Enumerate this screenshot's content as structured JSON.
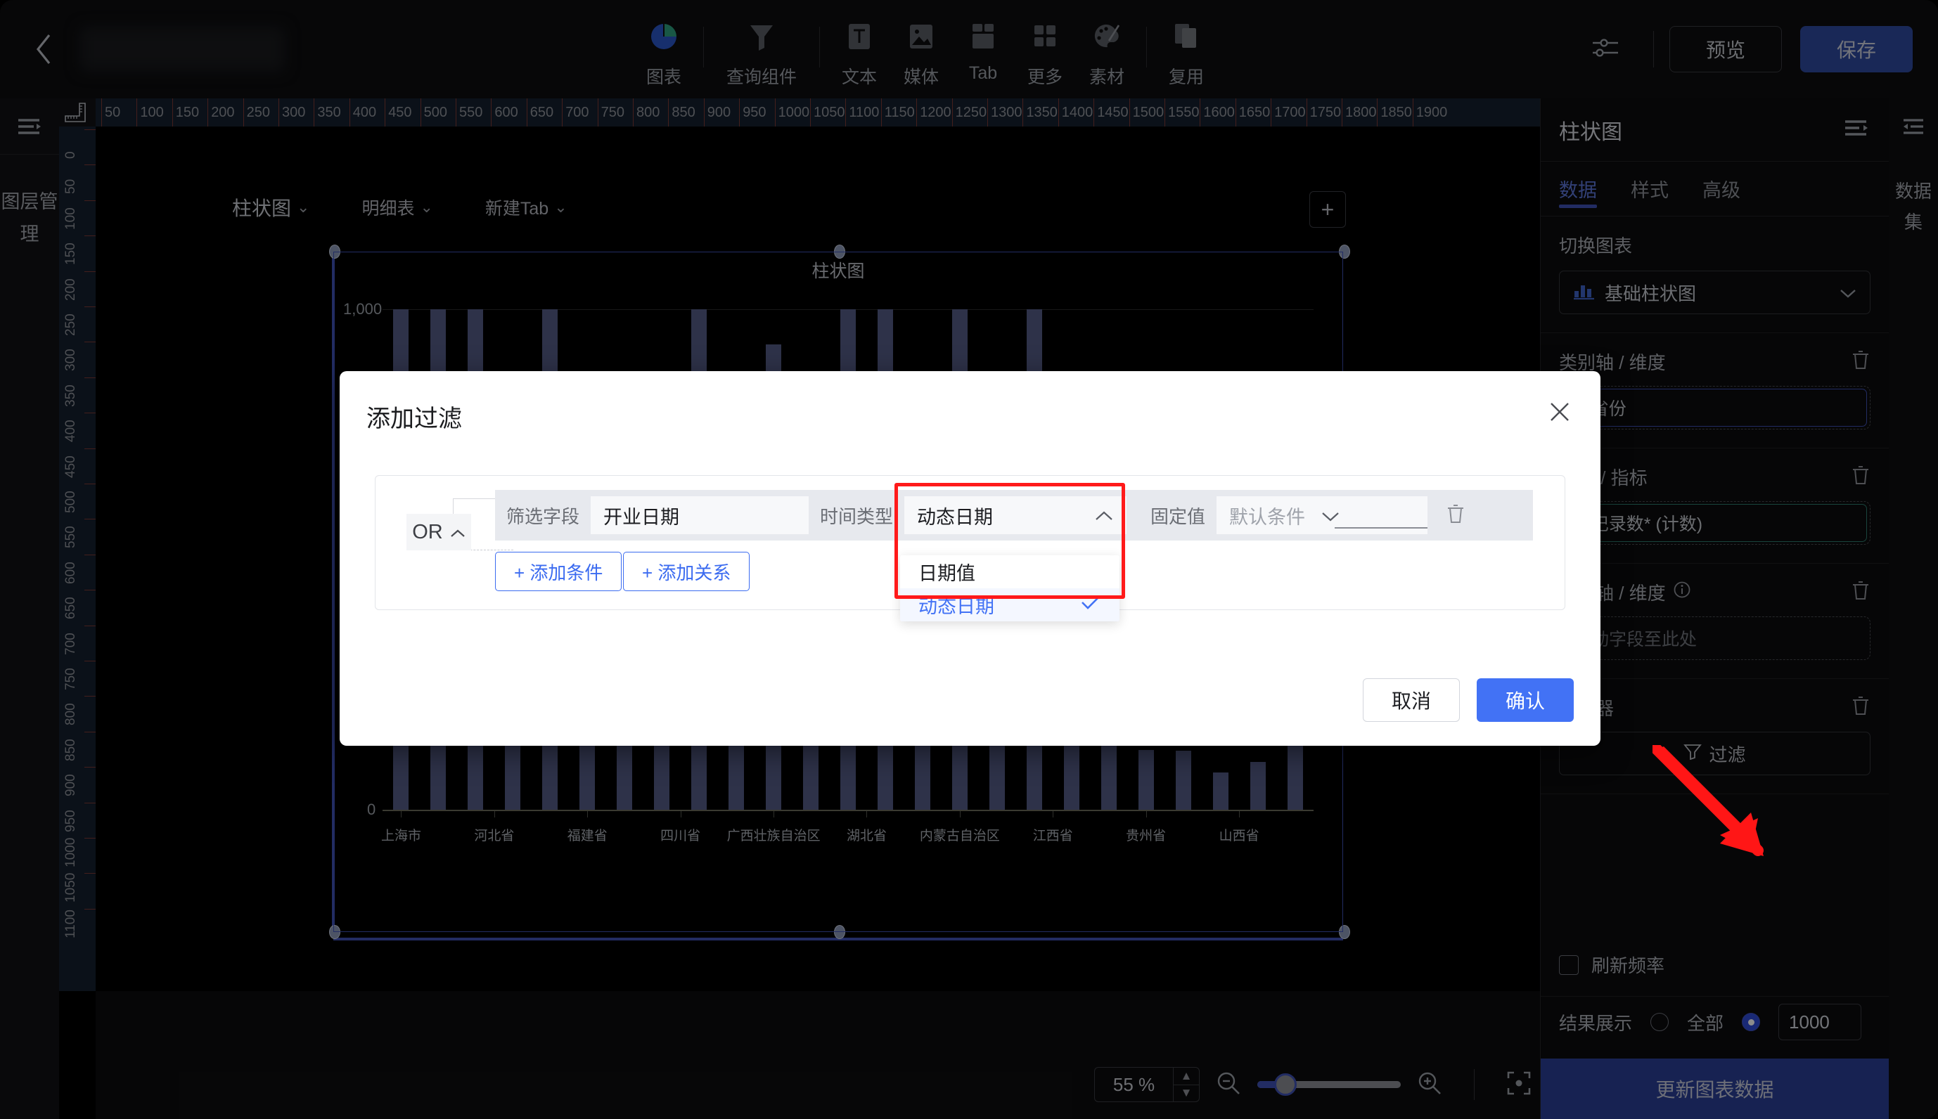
{
  "topbar": {
    "back_icon": "chevron-left-icon",
    "tools": [
      {
        "label": "图表",
        "icon": "pie-chart-icon"
      },
      {
        "label": "查询组件",
        "icon": "filter-funnel-icon"
      },
      {
        "label": "文本",
        "icon": "text-box-icon"
      },
      {
        "label": "媒体",
        "icon": "image-icon"
      },
      {
        "label": "Tab",
        "icon": "tab-icon"
      },
      {
        "label": "更多",
        "icon": "grid-more-icon"
      },
      {
        "label": "素材",
        "icon": "palette-icon"
      },
      {
        "label": "复用",
        "icon": "copy-reuse-icon"
      }
    ],
    "settings_icon": "sliders-icon",
    "preview_label": "预览",
    "save_label": "保存"
  },
  "leftrail": {
    "menu_icon": "hamburger-menu-icon",
    "label": "图层管理"
  },
  "rulers": {
    "h_ticks": [
      50,
      100,
      150,
      200,
      250,
      300,
      350,
      400,
      450,
      500,
      550,
      600,
      650,
      700,
      750,
      800,
      850,
      900,
      950,
      1000,
      1050,
      1100,
      1150,
      1200,
      1250,
      1300,
      1350,
      1400,
      1450,
      1500,
      1550,
      1600,
      1650,
      1700,
      1750,
      1800,
      1850,
      1900
    ],
    "v_ticks": [
      0,
      50,
      100,
      150,
      200,
      250,
      300,
      350,
      400,
      450,
      500,
      550,
      600,
      650,
      700,
      750,
      800,
      850,
      900,
      950,
      1000,
      1050,
      1100
    ]
  },
  "canvas": {
    "tabs": [
      {
        "label": "柱状图"
      },
      {
        "label": "明细表"
      },
      {
        "label": "新建Tab"
      }
    ],
    "add_icon": "plus-icon",
    "selection_label": "柱状图"
  },
  "chart_data": {
    "type": "bar",
    "title": "柱状图",
    "xlabel": "",
    "ylabel": "",
    "ylim": [
      0,
      1000
    ],
    "grid": true,
    "legend": false,
    "ytick_labels": [
      "1,000",
      "0"
    ],
    "ytick_values": [
      1000,
      0
    ],
    "categories": [
      "上海市",
      "",
      "",
      "河北省",
      "",
      "福建省",
      "",
      "",
      "四川省",
      "",
      "广西壮族自治区",
      "",
      "湖北省",
      "",
      "",
      "内蒙古自治区",
      "",
      "江西省",
      "",
      "",
      "贵州省",
      "",
      "山西省"
    ],
    "xtick_labels": [
      "上海市",
      "河北省",
      "福建省",
      "四川省",
      "广西壮族自治区",
      "湖北省",
      "内蒙古自治区",
      "江西省",
      "贵州省",
      "山西省"
    ],
    "values": [
      1000,
      1000,
      1000,
      430,
      1000,
      670,
      690,
      800,
      1000,
      545,
      930,
      195,
      1000,
      1000,
      555,
      1000,
      135,
      1000,
      325,
      395,
      120,
      118,
      75,
      95,
      175
    ],
    "bar_color": "#555b86"
  },
  "bottombar": {
    "zoom_value": "55 %",
    "zoom_out_icon": "zoom-out-icon",
    "zoom_in_icon": "zoom-in-icon",
    "fit_icon": "fit-to-screen-icon",
    "stepper_up": "▲",
    "stepper_down": "▼"
  },
  "rightpanel": {
    "title": "柱状图",
    "panel_icon": "panel-collapse-icon",
    "tabs": [
      {
        "label": "数据",
        "active": true
      },
      {
        "label": "样式",
        "active": false
      },
      {
        "label": "高级",
        "active": false
      }
    ],
    "switch_chart_label": "切换图表",
    "switch_chart_value": "基础柱状图",
    "switch_chart_icon": "bar-chart-icon",
    "category_axis_label": "类别轴 / 维度",
    "category_field": "省份",
    "value_axis_label": "值轴 / 指标",
    "value_field": "记录数* (计数)",
    "color_axis_label": "颜色轴 / 维度",
    "color_axis_info_icon": "info-icon",
    "color_field_placeholder": "拖动字段至此处",
    "filter_section_label": "过滤器",
    "filter_button_label": "过滤",
    "filter_icon": "funnel-icon",
    "delete_icon": "trash-icon",
    "refresh_label": "刷新频率",
    "result_label": "结果展示",
    "result_all_label": "全部",
    "result_limit": "1000",
    "update_button_label": "更新图表数据"
  },
  "farrail": {
    "icon": "panel-expand-icon",
    "label": "数据集"
  },
  "modal": {
    "title": "添加过滤",
    "close_icon": "close-icon",
    "operator_badge": "OR",
    "operator_caret": "caret-up-icon",
    "condition": {
      "field_label": "筛选字段",
      "field_value": "开业日期",
      "time_type_label": "时间类型",
      "time_type_value": "动态日期",
      "time_type_caret": "caret-up-icon",
      "fixed_label": "固定值",
      "fixed_placeholder": "默认条件",
      "fixed_caret": "caret-down-icon",
      "delete_icon": "trash-icon"
    },
    "add_condition_label": "+ 添加条件",
    "add_relation_label": "+ 添加关系",
    "dropdown_options": [
      {
        "label": "日期值",
        "selected": false
      },
      {
        "label": "动态日期",
        "selected": true
      }
    ],
    "check_icon": "check-icon",
    "cancel_label": "取消",
    "confirm_label": "确认"
  },
  "annotation": {
    "highlight_color": "#ff1a1a",
    "arrow_color": "#ff1616"
  }
}
